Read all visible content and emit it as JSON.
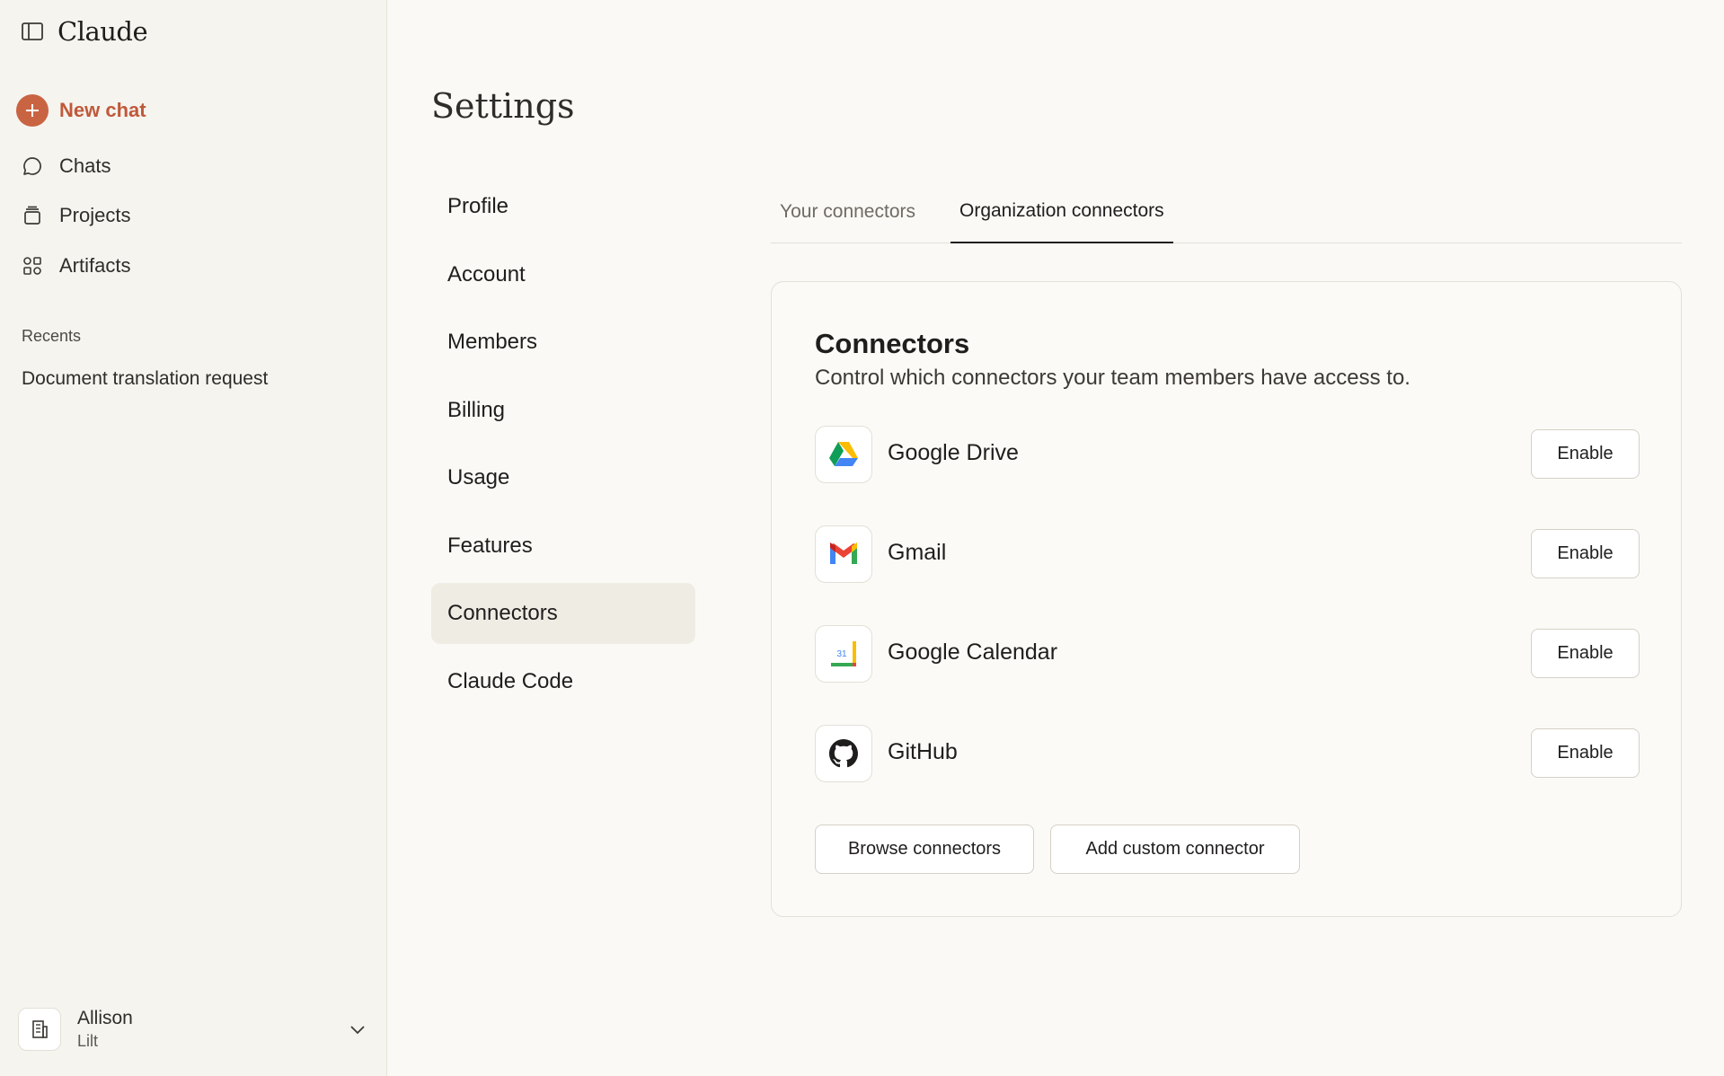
{
  "app": {
    "name": "Claude"
  },
  "sidebar": {
    "new_chat": "New chat",
    "items": [
      {
        "label": "Chats",
        "icon": "chat-bubble-icon"
      },
      {
        "label": "Projects",
        "icon": "projects-box-icon"
      },
      {
        "label": "Artifacts",
        "icon": "artifacts-shapes-icon"
      }
    ],
    "recents_title": "Recents",
    "recents": [
      "Document translation request"
    ],
    "user": {
      "name": "Allison",
      "org": "Lilt"
    }
  },
  "settings": {
    "title": "Settings",
    "nav": [
      "Profile",
      "Account",
      "Members",
      "Billing",
      "Usage",
      "Features",
      "Connectors",
      "Claude Code"
    ],
    "active_nav": "Connectors",
    "tabs": [
      "Your connectors",
      "Organization connectors"
    ],
    "active_tab": "Organization connectors",
    "card": {
      "title": "Connectors",
      "subtitle": "Control which connectors your team members have access to.",
      "connectors": [
        {
          "name": "Google Drive",
          "icon": "google-drive-icon",
          "action": "Enable"
        },
        {
          "name": "Gmail",
          "icon": "gmail-icon",
          "action": "Enable"
        },
        {
          "name": "Google Calendar",
          "icon": "google-calendar-icon",
          "action": "Enable",
          "icon_text": "31"
        },
        {
          "name": "GitHub",
          "icon": "github-icon",
          "action": "Enable"
        }
      ],
      "browse_label": "Browse connectors",
      "custom_label": "Add custom connector"
    }
  },
  "colors": {
    "accent": "#c96442",
    "background": "#faf9f5",
    "sidebar": "#f5f4ef"
  }
}
